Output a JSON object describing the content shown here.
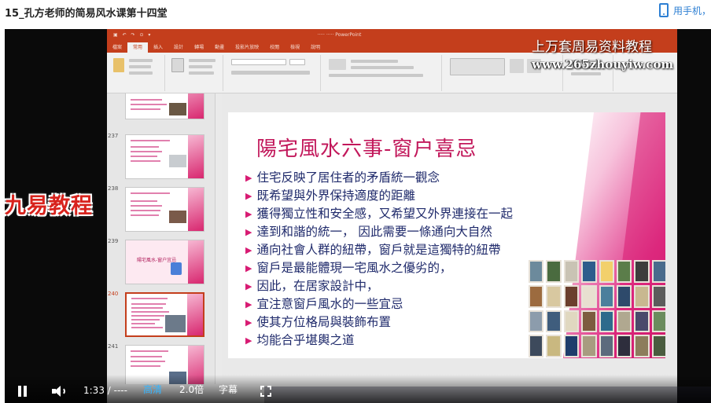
{
  "page": {
    "video_title": "15_孔方老师的简易风水课第十四堂",
    "phone_link": "用手机，"
  },
  "ppt": {
    "tabs": [
      "檔案",
      "常用",
      "插入",
      "設計",
      "轉場",
      "動畫",
      "投影片放映",
      "校閱",
      "檢視",
      "說明"
    ],
    "active_tab": 1,
    "overlay_title": "上万套周易资料教程",
    "overlay_url": "www.265zhouyiw.com",
    "thumb_numbers": [
      "237",
      "238",
      "239",
      "240",
      "241"
    ],
    "thumb_239_title": "陽宅風水-窗户宜忌",
    "slide": {
      "title": "陽宅風水六事-窗户喜忌",
      "bullets": [
        "住宅反映了居住者的矛盾統一觀念",
        "既希望與外界保持適度的距離",
        "獲得獨立性和安全感，又希望又外界連接在一起",
        "達到和諧的統一， 因此需要一條通向大自然",
        "通向社會人群的紐帶，窗戶就是這獨特的紐帶",
        "窗戶是最能體現一宅風水之優劣的，",
        "因此，在居家設計中，",
        "宜注意窗戶風水的一些宜忌",
        "使其方位格局與裝飾布置",
        "均能合乎堪輿之道"
      ],
      "window_colors": [
        "#6c8a9c",
        "#4a6b3f",
        "#c9c3b4",
        "#2e5d8c",
        "#f2d06b",
        "#5b7d4a",
        "#3d3d3d",
        "#4a6b8c",
        "#9c6b3f",
        "#d8c8a0",
        "#6b3f2e",
        "#e8e0d0",
        "#4a7f9c",
        "#2e4a6b",
        "#c8b890",
        "#5c5c5c",
        "#8c9cac",
        "#3f5d7d",
        "#e0d8c0",
        "#7d5c3f",
        "#2e6b8c",
        "#b0a890",
        "#4a4a6b",
        "#6b8c5d",
        "#3d4a5c",
        "#c9b880",
        "#1f3d6b",
        "#a89c80",
        "#5c6b7d",
        "#2e2e3d",
        "#8c7d5c",
        "#4a5c3f"
      ]
    }
  },
  "watermark": "九易教程",
  "controls": {
    "time": "1:33 / ----",
    "quality": "高清",
    "speed": "2.0倍",
    "subtitles": "字幕"
  }
}
